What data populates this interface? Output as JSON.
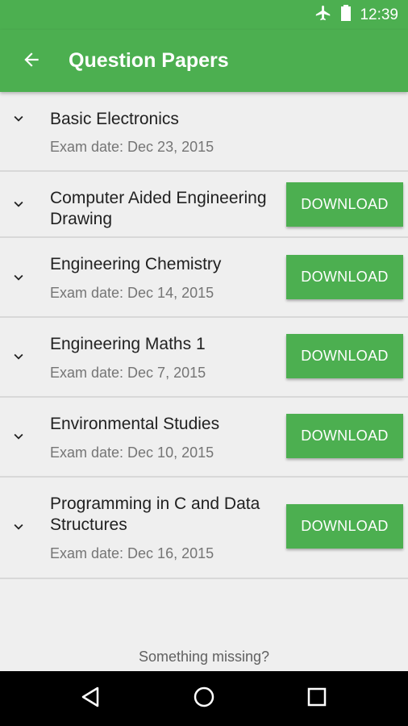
{
  "status_bar": {
    "time": "12:39",
    "icons": [
      "airplane-mode-icon",
      "battery-icon"
    ]
  },
  "app_bar": {
    "title": "Question Papers",
    "back_icon": "arrow-back-icon"
  },
  "colors": {
    "accent": "#4caf50",
    "background": "#efefef",
    "divider": "#d8d8d8",
    "secondary_text": "#757575"
  },
  "papers": [
    {
      "title": "Basic Electronics",
      "date": "Exam date: Dec 23, 2015",
      "download": ""
    },
    {
      "title": "Computer Aided Engineering Drawing",
      "date": "",
      "download": "DOWNLOAD"
    },
    {
      "title": "Engineering Chemistry",
      "date": "Exam date: Dec 14, 2015",
      "download": "DOWNLOAD"
    },
    {
      "title": "Engineering Maths 1",
      "date": "Exam date: Dec 7, 2015",
      "download": "DOWNLOAD"
    },
    {
      "title": "Environmental Studies",
      "date": "Exam date: Dec 10, 2015",
      "download": "DOWNLOAD"
    },
    {
      "title": "Programming in C and Data Structures",
      "date": "Exam date: Dec 16, 2015",
      "download": "DOWNLOAD"
    }
  ],
  "footer": {
    "text": "Something missing?"
  },
  "nav_bar": {
    "buttons": [
      "back-icon",
      "home-icon",
      "recents-icon"
    ]
  }
}
